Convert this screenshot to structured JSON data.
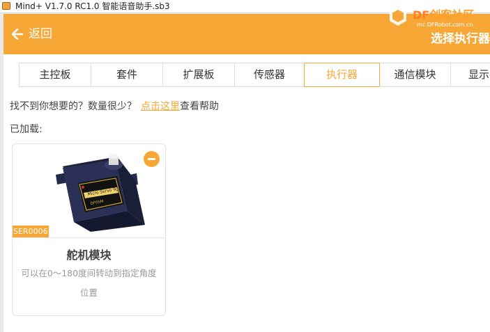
{
  "window": {
    "title": "Mind+ V1.7.0 RC1.0   智能语音助手.sb3"
  },
  "watermark": {
    "brand_df": "DF",
    "brand_rest": "创客社区",
    "url": "mc.DFRobot.com.cn"
  },
  "header": {
    "back_label": "返回",
    "title": "选择执行器"
  },
  "tabs": [
    {
      "label": "主控板",
      "active": false
    },
    {
      "label": "套件",
      "active": false
    },
    {
      "label": "扩展板",
      "active": false
    },
    {
      "label": "传感器",
      "active": false
    },
    {
      "label": "执行器",
      "active": true
    },
    {
      "label": "通信模块",
      "active": false
    },
    {
      "label": "显示",
      "active": false
    }
  ],
  "help": {
    "prefix": "找不到你想要的？数量很少？",
    "link": "点击这里",
    "suffix": "查看帮助"
  },
  "loaded_label": "已加载:",
  "cards": [
    {
      "sku": "SER0006",
      "name": "舵机模块",
      "description": "可以在0～180度间转动到指定角度位置"
    }
  ],
  "colors": {
    "accent": "#f7a735",
    "header_bg": "#f7a735"
  }
}
